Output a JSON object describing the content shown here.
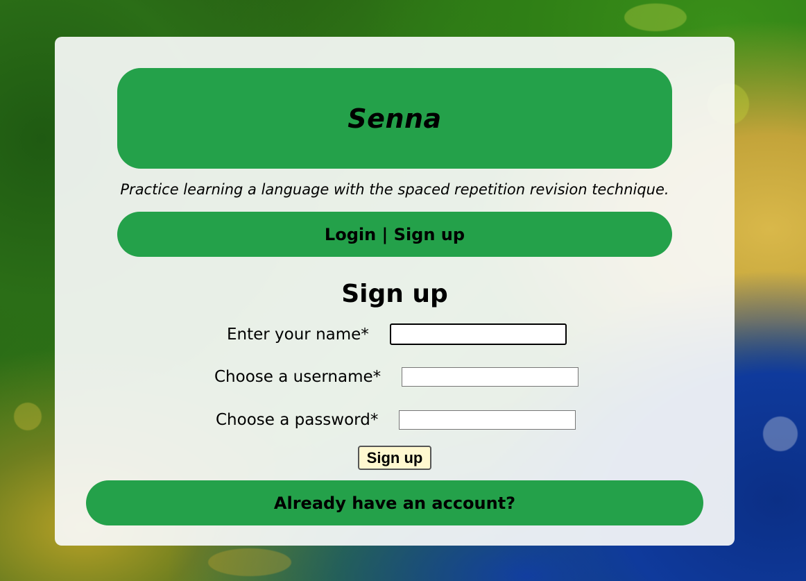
{
  "app": {
    "title": "Senna",
    "tagline": "Practice learning a language with the spaced repetition revision technique."
  },
  "nav": {
    "login_label": "Login",
    "separator": " | ",
    "signup_label": "Sign up"
  },
  "form": {
    "heading": "Sign up",
    "fields": [
      {
        "label": "Enter your name*",
        "value": ""
      },
      {
        "label": "Choose a username*",
        "value": ""
      },
      {
        "label": "Choose a password*",
        "value": ""
      }
    ],
    "submit_label": "Sign up"
  },
  "footer_link": {
    "label": "Already have an account?"
  },
  "colors": {
    "accent_green": "#24a14a",
    "card_background": "#f8fafa",
    "submit_background": "#fff8d0"
  }
}
